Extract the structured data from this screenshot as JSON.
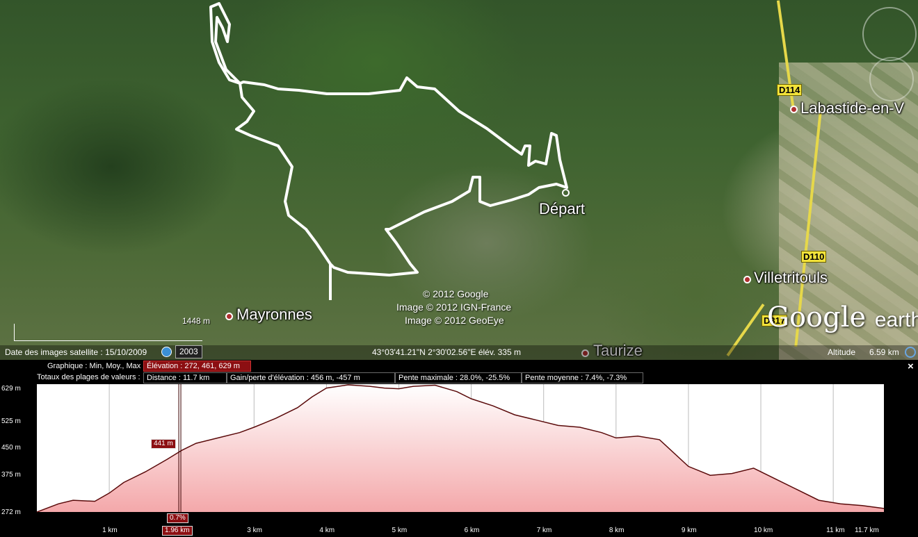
{
  "map": {
    "places": [
      {
        "name": "Labastide-en-V"
      },
      {
        "name": "Départ"
      },
      {
        "name": "Villetritouls"
      },
      {
        "name": "Mayronnes"
      },
      {
        "name": "Taurize"
      }
    ],
    "roads": [
      "D114",
      "D110",
      "D317"
    ],
    "credits": [
      "© 2012 Google",
      "Image © 2012 IGN-France",
      "Image © 2012 GeoEye"
    ],
    "logo": {
      "main": "Google",
      "suffix": "earth"
    },
    "scale_label": "1448",
    "scale_unit": "m"
  },
  "statusbar": {
    "imagery_date": "Date des images satellite : 15/10/2009",
    "year": "2003",
    "coords": "43°03'41.21\"N    2°30'02.56\"E  élév.  335 m",
    "altitude_label": "Altitude",
    "altitude_value": "6.59 km"
  },
  "profile": {
    "graph_label": "Graphique : Min, Moy., Max",
    "elevation": "Élévation : 272, 461, 629 m",
    "totals_label": "Totaux des plages de valeurs :",
    "distance": "Distance : 11.7 km",
    "gain": "Gain/perte d'élévation : 456 m, -457 m",
    "max_slope": "Pente maximale : 28.0%, -25.5%",
    "avg_slope": "Pente moyenne : 7.4%, -7.3%",
    "close_label": "×",
    "cursor_elev": "441 m",
    "cursor_slope": "0.7%",
    "cursor_dist": "1.96 km",
    "fill_color": "#f4a8aa",
    "line_color": "#5a0a0a"
  },
  "chart_data": {
    "type": "area",
    "x": [
      0,
      0.3,
      0.5,
      0.8,
      1.0,
      1.2,
      1.5,
      1.8,
      2.0,
      2.2,
      2.5,
      2.8,
      3.0,
      3.3,
      3.6,
      3.8,
      4.0,
      4.3,
      4.6,
      4.8,
      5.0,
      5.2,
      5.5,
      5.8,
      6.0,
      6.3,
      6.6,
      6.9,
      7.2,
      7.5,
      7.8,
      8.0,
      8.3,
      8.6,
      9.0,
      9.3,
      9.6,
      9.9,
      10.2,
      10.5,
      10.8,
      11.1,
      11.4,
      11.7
    ],
    "y": [
      272,
      295,
      305,
      302,
      325,
      355,
      385,
      420,
      445,
      465,
      480,
      495,
      510,
      535,
      565,
      595,
      620,
      629,
      625,
      620,
      618,
      625,
      628,
      610,
      590,
      570,
      545,
      530,
      515,
      510,
      495,
      480,
      485,
      475,
      400,
      375,
      380,
      395,
      365,
      335,
      305,
      295,
      290,
      282
    ],
    "xlabel": "",
    "ylabel": "",
    "y_ticks": [
      "272 m",
      "375 m",
      "450 m",
      "525 m",
      "629 m"
    ],
    "y_tick_values": [
      272,
      375,
      450,
      525,
      629
    ],
    "x_ticks": [
      "1 km",
      "1.96 km",
      "3 km",
      "4 km",
      "5 km",
      "6 km",
      "7 km",
      "8 km",
      "9 km",
      "10 km",
      "11 km",
      "11.7 km"
    ],
    "x_tick_values": [
      1,
      1.96,
      3,
      4,
      5,
      6,
      7,
      8,
      9,
      10,
      11,
      11.7
    ],
    "xlim": [
      0,
      11.7
    ],
    "ylim": [
      272,
      629
    ],
    "grid": true,
    "cursor_x": 1.96
  }
}
